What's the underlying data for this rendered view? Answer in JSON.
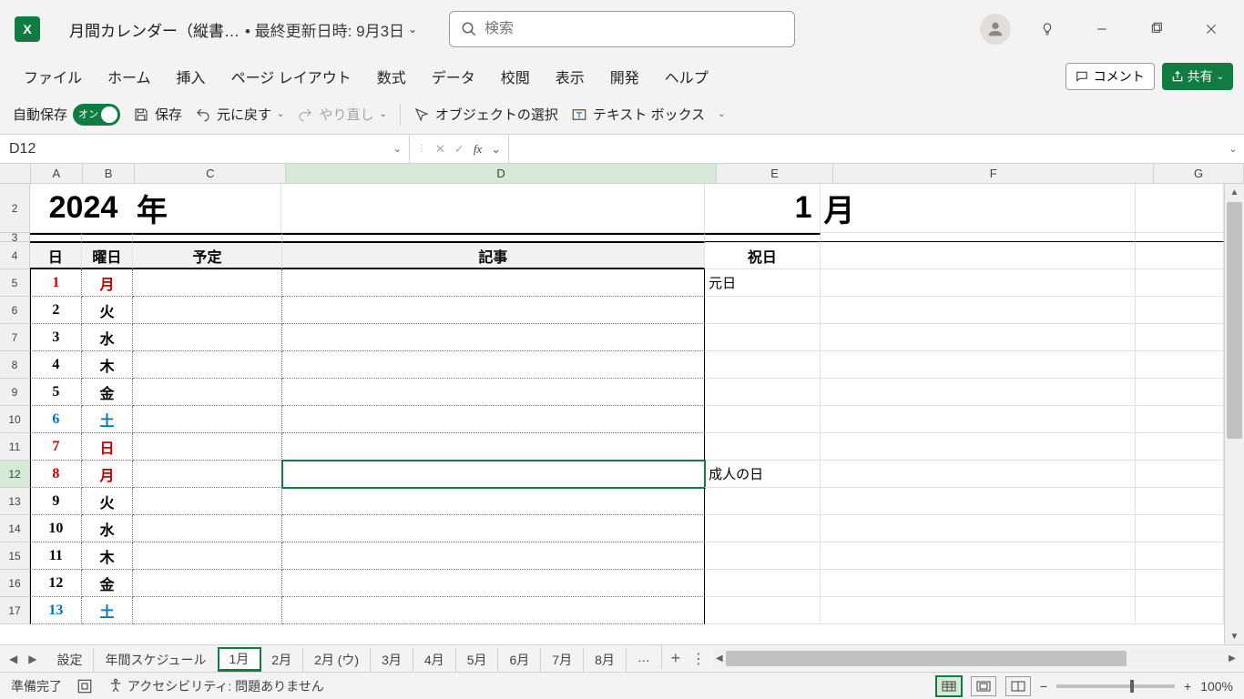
{
  "app": {
    "letter": "X"
  },
  "title": {
    "doc": "月間カレンダー（縦書…",
    "saved": "• 最終更新日時: 9月3日"
  },
  "search": {
    "placeholder": "検索"
  },
  "ribbon": {
    "tabs": [
      "ファイル",
      "ホーム",
      "挿入",
      "ページ レイアウト",
      "数式",
      "データ",
      "校閲",
      "表示",
      "開発",
      "ヘルプ"
    ],
    "comment": "コメント",
    "share": "共有"
  },
  "qat": {
    "autosave": "自動保存",
    "autosave_on": "オン",
    "save": "保存",
    "undo": "元に戻す",
    "redo": "やり直し",
    "select_objects": "オブジェクトの選択",
    "textbox": "テキスト ボックス"
  },
  "namebox": "D12",
  "cols": [
    "A",
    "B",
    "C",
    "D",
    "E",
    "F",
    "G"
  ],
  "row2": {
    "A": "2024",
    "C": "年",
    "E": "1",
    "F": "月"
  },
  "row4": {
    "A": "日",
    "B": "曜日",
    "C": "予定",
    "D": "記事",
    "E": "祝日"
  },
  "days": [
    {
      "n": "1",
      "w": "月",
      "cls": "red",
      "hol": "元日"
    },
    {
      "n": "2",
      "w": "火",
      "cls": ""
    },
    {
      "n": "3",
      "w": "水",
      "cls": ""
    },
    {
      "n": "4",
      "w": "木",
      "cls": ""
    },
    {
      "n": "5",
      "w": "金",
      "cls": ""
    },
    {
      "n": "6",
      "w": "土",
      "cls": "blue"
    },
    {
      "n": "7",
      "w": "日",
      "cls": "red"
    },
    {
      "n": "8",
      "w": "月",
      "cls": "red",
      "hol": "成人の日"
    },
    {
      "n": "9",
      "w": "火",
      "cls": ""
    },
    {
      "n": "10",
      "w": "水",
      "cls": ""
    },
    {
      "n": "11",
      "w": "木",
      "cls": ""
    },
    {
      "n": "12",
      "w": "金",
      "cls": ""
    },
    {
      "n": "13",
      "w": "土",
      "cls": "blue"
    }
  ],
  "sheets": {
    "list": [
      "設定",
      "年間スケジュール",
      "1月",
      "2月",
      "2月 (ウ)",
      "3月",
      "4月",
      "5月",
      "6月",
      "7月",
      "8月"
    ],
    "active": "1月",
    "more": "…"
  },
  "status": {
    "ready": "準備完了",
    "access": "アクセシビリティ: 問題ありません",
    "zoom": "100%"
  }
}
